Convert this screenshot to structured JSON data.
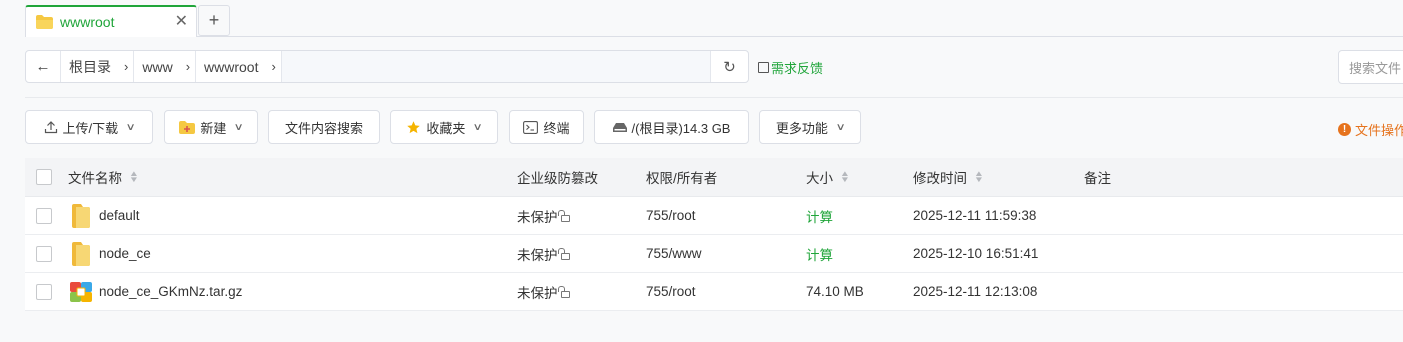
{
  "tab": {
    "label": "wwwroot",
    "close": "✕",
    "add": "+"
  },
  "pathbar": {
    "back": "←",
    "crumbs": [
      "根目录",
      "www",
      "wwwroot"
    ],
    "separator": "›",
    "refresh": "↻"
  },
  "feedback": "需求反馈",
  "search": {
    "placeholder": "搜索文件"
  },
  "toolbar": {
    "upload": "上传/下载",
    "new": "新建",
    "content_search": "文件内容搜索",
    "favorites": "收藏夹",
    "terminal": "终端",
    "disk": "/(根目录)14.3 GB",
    "more": "更多功能",
    "file_ops": "文件操作"
  },
  "table": {
    "headers": {
      "name": "文件名称",
      "protect": "企业级防篡改",
      "perm": "权限/所有者",
      "size": "大小",
      "mtime": "修改时间",
      "note": "备注"
    },
    "rows": [
      {
        "name": "default",
        "icon": "folder-icon",
        "protect": "未保护",
        "perm": "755/root",
        "size": "计算",
        "mtime": "2025-12-11 11:59:38"
      },
      {
        "name": "node_ce",
        "icon": "folder-icon",
        "protect": "未保护",
        "perm": "755/www",
        "size": "计算",
        "mtime": "2025-12-10 16:51:41"
      },
      {
        "name": "node_ce_GKmNz.tar.gz",
        "icon": "archive-icon",
        "protect": "未保护",
        "perm": "755/root",
        "size": "74.10 MB",
        "mtime": "2025-12-11 12:13:08"
      }
    ]
  },
  "colors": {
    "accent": "#20a53a",
    "warning": "#e6731d",
    "folder": "#f5c842"
  }
}
